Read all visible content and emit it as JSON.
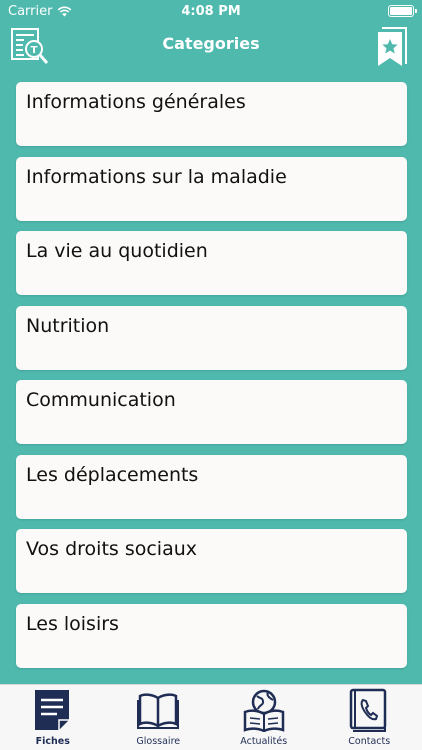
{
  "status_bar": {
    "carrier": "Carrier",
    "time": "4:08 PM"
  },
  "nav": {
    "title": "Categories",
    "left_icon": "glossary-search-icon",
    "right_icon": "bookmark-star-icon"
  },
  "categories": [
    {
      "label": "Informations générales"
    },
    {
      "label": "Informations sur la maladie"
    },
    {
      "label": "La vie au quotidien"
    },
    {
      "label": "Nutrition"
    },
    {
      "label": "Communication"
    },
    {
      "label": "Les déplacements"
    },
    {
      "label": "Vos droits sociaux"
    },
    {
      "label": "Les loisirs"
    }
  ],
  "tabs": [
    {
      "label": "Fiches",
      "icon": "document-icon",
      "active": true
    },
    {
      "label": "Glossaire",
      "icon": "book-icon",
      "active": false
    },
    {
      "label": "Actualités",
      "icon": "globe-book-icon",
      "active": false
    },
    {
      "label": "Contacts",
      "icon": "phone-book-icon",
      "active": false
    }
  ],
  "colors": {
    "background": "#4fb9ae",
    "card": "#fbfaf8",
    "tab_icon": "#1f2d55"
  }
}
